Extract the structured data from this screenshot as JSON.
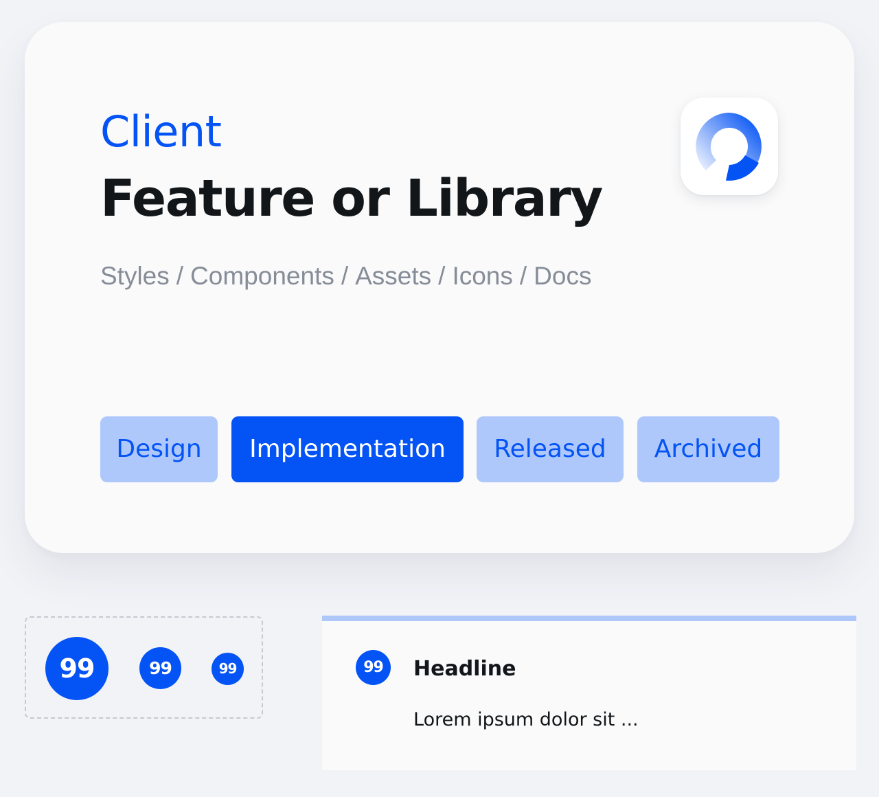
{
  "header": {
    "client": "Client",
    "title": "Feature or Library",
    "breadcrumb": [
      "Styles",
      "Components",
      "Assets",
      "Icons",
      "Docs"
    ],
    "separator": "/"
  },
  "app_icon": {
    "icon": "brand-ring-icon",
    "color": "#0353f5"
  },
  "tags": [
    {
      "label": "Design",
      "active": false
    },
    {
      "label": "Implementation",
      "active": true
    },
    {
      "label": "Released",
      "active": false
    },
    {
      "label": "Archived",
      "active": false
    }
  ],
  "badges": {
    "large": "99",
    "medium": "99",
    "small": "99"
  },
  "notification": {
    "badge": "99",
    "headline": "Headline",
    "body": "Lorem ipsum dolor sit ..."
  },
  "colors": {
    "accent": "#0353f5",
    "accent_light": "#afc8fb",
    "text_primary": "#121619",
    "text_secondary": "#868d98",
    "background": "#f2f3f7",
    "card": "#fafafa"
  }
}
